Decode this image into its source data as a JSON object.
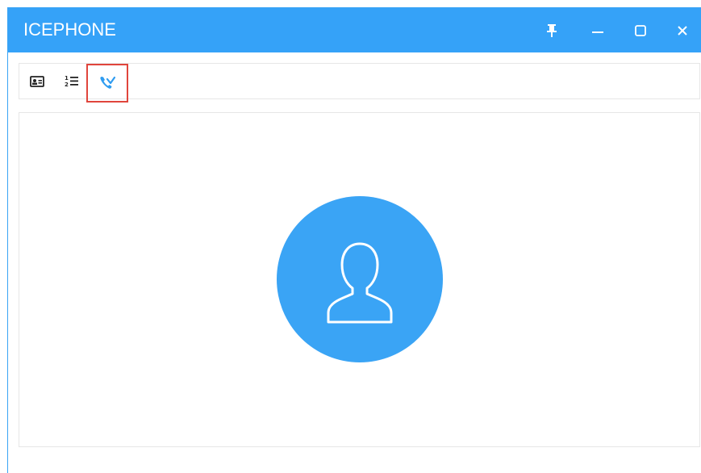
{
  "window": {
    "title": "ICEPHONE",
    "accent_color": "#35a2f8"
  },
  "title_buttons": [
    {
      "name": "pin-icon"
    },
    {
      "name": "minimize-icon"
    },
    {
      "name": "maximize-icon"
    },
    {
      "name": "close-icon"
    }
  ],
  "toolbar": {
    "tools": [
      {
        "name": "contact-card-icon",
        "selected": false
      },
      {
        "name": "numbered-list-icon",
        "selected": false
      },
      {
        "name": "missed-call-icon",
        "selected": true
      }
    ]
  },
  "content": {
    "avatar_icon": "user-avatar-icon"
  }
}
